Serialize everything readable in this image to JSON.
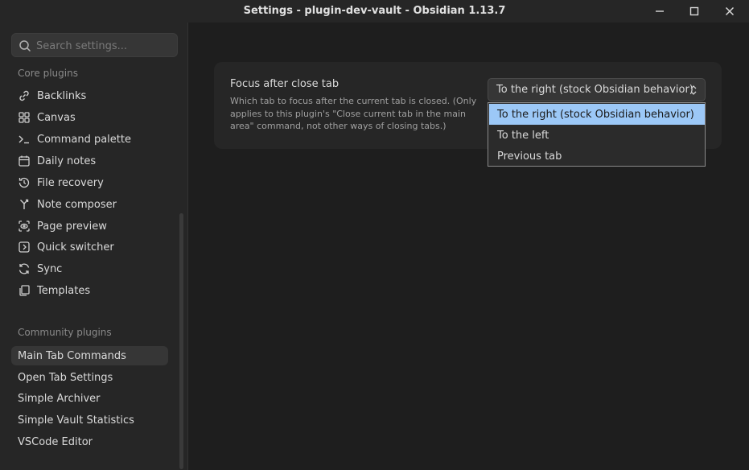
{
  "window": {
    "title": "Settings - plugin-dev-vault - Obsidian 1.13.7"
  },
  "sidebar": {
    "search_placeholder": "Search settings...",
    "core_heading": "Core plugins",
    "core_items": [
      {
        "label": "Backlinks",
        "icon": "backlinks-icon"
      },
      {
        "label": "Canvas",
        "icon": "canvas-icon"
      },
      {
        "label": "Command palette",
        "icon": "terminal-icon"
      },
      {
        "label": "Daily notes",
        "icon": "calendar-icon"
      },
      {
        "label": "File recovery",
        "icon": "history-icon"
      },
      {
        "label": "Note composer",
        "icon": "merge-icon"
      },
      {
        "label": "Page preview",
        "icon": "preview-icon"
      },
      {
        "label": "Quick switcher",
        "icon": "switcher-icon"
      },
      {
        "label": "Sync",
        "icon": "sync-icon"
      },
      {
        "label": "Templates",
        "icon": "templates-icon"
      }
    ],
    "community_heading": "Community plugins",
    "community_items": [
      {
        "label": "Main Tab Commands",
        "active": true
      },
      {
        "label": "Open Tab Settings"
      },
      {
        "label": "Simple Archiver"
      },
      {
        "label": "Simple Vault Statistics"
      },
      {
        "label": "VSCode Editor"
      }
    ]
  },
  "setting": {
    "name": "Focus after close tab",
    "description": "Which tab to focus after the current tab is closed. (Only applies to this plugin's \"Close current tab in the main area\" command, not other ways of closing tabs.)",
    "selected_value": "To the right (stock Obsidian behavior)",
    "options": [
      "To the right (stock Obsidian behavior)",
      "To the left",
      "Previous tab"
    ]
  },
  "colors": {
    "background": "#1e1e1e",
    "sidebar": "#262626",
    "selection_highlight": "#9cc8f7"
  }
}
